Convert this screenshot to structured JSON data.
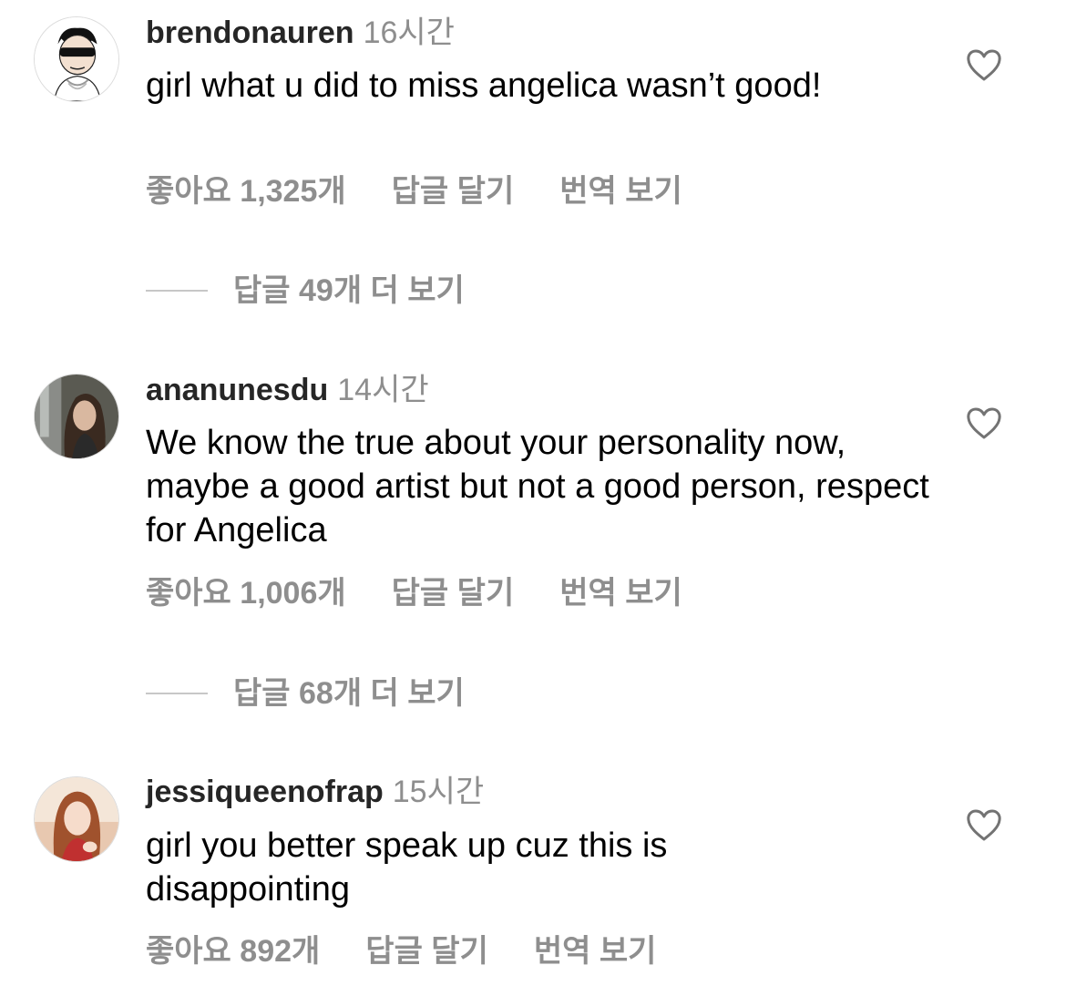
{
  "comments": [
    {
      "username": "brendonauren",
      "time": "16시간",
      "text": "girl what u did to miss angelica wasn’t good!",
      "likes": "좋아요 1,325개",
      "reply_label": "답글 달기",
      "translate_label": "번역 보기",
      "more_replies": "답글 49개 더 보기"
    },
    {
      "username": "ananunesdu",
      "time": "14시간",
      "text": "We know the true about your personality now, maybe a good artist but not a good person, respect for Angelica",
      "likes": "좋아요 1,006개",
      "reply_label": "답글 달기",
      "translate_label": "번역 보기",
      "more_replies": "답글 68개 더 보기"
    },
    {
      "username": "jessiqueenofrap",
      "time": "15시간",
      "text": "girl you better speak up cuz this is disappointing",
      "likes": "좋아요 892개",
      "reply_label": "답글 달기",
      "translate_label": "번역 보기"
    }
  ],
  "colors": {
    "username": "#262626",
    "secondary": "#8e8e8e",
    "text": "#000000",
    "divider": "#c7c7c7"
  },
  "icons": {
    "like": "heart-outline-icon"
  }
}
